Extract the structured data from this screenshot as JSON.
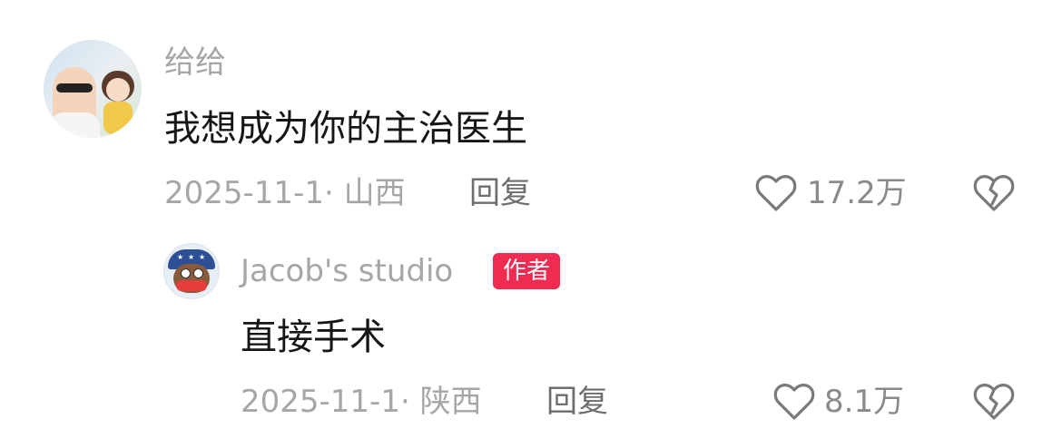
{
  "comments": [
    {
      "username": "给给",
      "text": "我想成为你的主治医生",
      "date_location": "2025-11-1· 山西",
      "reply_label": "回复",
      "likes": "17.2万",
      "avatar_icon": "user-photo-avatar"
    },
    {
      "username": "Jacob's studio",
      "author_badge": "作者",
      "text": "直接手术",
      "date_location": "2025-11-1· 陕西",
      "reply_label": "回复",
      "likes": "8.1万",
      "avatar_icon": "monkey-avatar"
    }
  ],
  "icons": {
    "like": "heart-outline-icon",
    "dislike": "broken-heart-icon"
  },
  "colors": {
    "badge": "#f02b52",
    "secondary_text": "#a6a6a6",
    "primary_text": "#161616"
  }
}
